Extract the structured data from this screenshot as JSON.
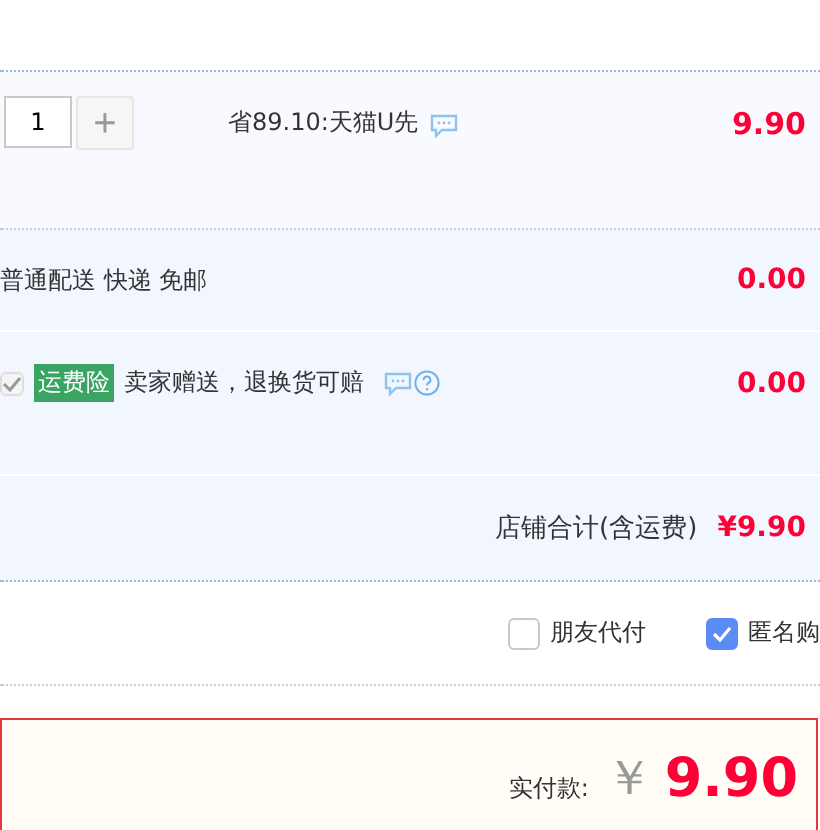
{
  "item": {
    "quantity": "1",
    "plus": "+",
    "promo": "省89.10:天猫U先",
    "price": "9.90"
  },
  "shipping": {
    "method": "普通配送 快递 免邮",
    "fee": "0.00"
  },
  "insurance": {
    "checked": true,
    "disabled": true,
    "tag": "运费险",
    "text": "卖家赠送，退换货可赔",
    "fee": "0.00"
  },
  "shop_total": {
    "label": "店铺合计(含运费)",
    "amount": "¥9.90"
  },
  "options": [
    {
      "label": "朋友代付",
      "checked": false
    },
    {
      "label": "匿名购",
      "checked": true
    }
  ],
  "payment": {
    "label": "实付款:",
    "currency": "￥",
    "amount": "9.90"
  }
}
